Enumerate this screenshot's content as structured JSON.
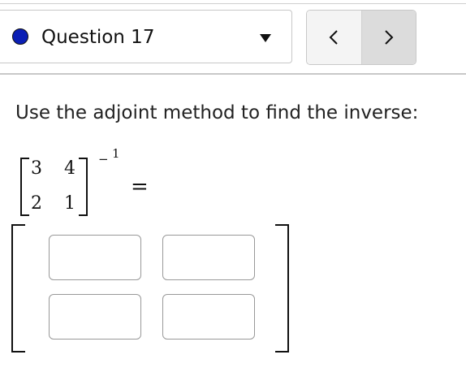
{
  "header": {
    "question_label": "Question 17",
    "status_color": "#0b1fb5",
    "dropdown_icon": "caret-down-icon",
    "prev_label": "<",
    "next_label": ">"
  },
  "prompt": {
    "text": "Use the adjoint method to find the inverse:"
  },
  "matrix": {
    "rows": [
      [
        "3",
        "4"
      ],
      [
        "2",
        "1"
      ]
    ],
    "exponent_sign": "−",
    "exponent_value": "1",
    "equals": "="
  },
  "answer": {
    "cells": [
      {
        "value": "",
        "placeholder": ""
      },
      {
        "value": "",
        "placeholder": ""
      },
      {
        "value": "",
        "placeholder": ""
      },
      {
        "value": "",
        "placeholder": ""
      }
    ]
  }
}
